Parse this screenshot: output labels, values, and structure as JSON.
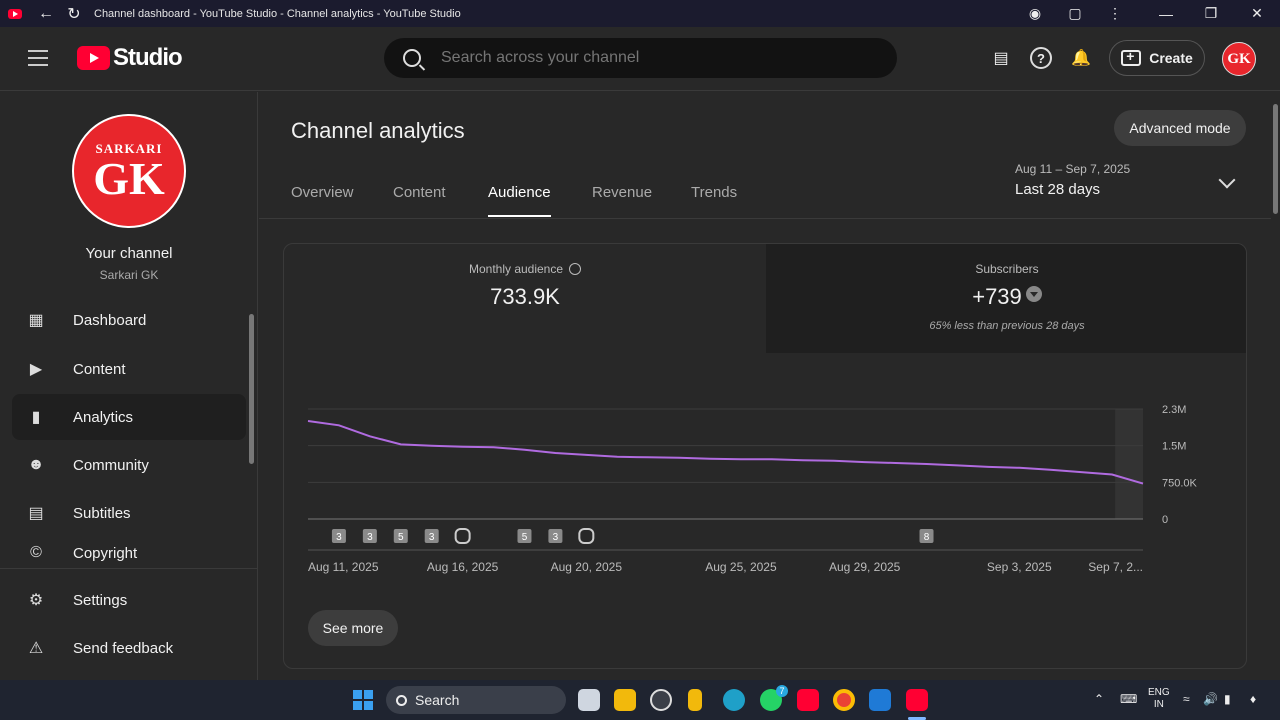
{
  "browser": {
    "title": "Channel dashboard - YouTube Studio - Channel analytics - YouTube Studio"
  },
  "header": {
    "logo_text": "Studio",
    "search_placeholder": "Search across your channel",
    "create_label": "Create",
    "avatar_text": "GK"
  },
  "sidebar": {
    "avatar_top": "SARKARI",
    "avatar_main": "GK",
    "channel_title": "Your channel",
    "channel_name": "Sarkari GK",
    "items": [
      {
        "label": "Dashboard",
        "icon": "dashboard-icon"
      },
      {
        "label": "Content",
        "icon": "content-icon"
      },
      {
        "label": "Analytics",
        "icon": "analytics-icon"
      },
      {
        "label": "Community",
        "icon": "community-icon"
      },
      {
        "label": "Subtitles",
        "icon": "subtitles-icon"
      },
      {
        "label": "Copyright",
        "icon": "copyright-icon"
      },
      {
        "label": "Settings",
        "icon": "settings-icon"
      },
      {
        "label": "Send feedback",
        "icon": "feedback-icon"
      }
    ]
  },
  "main": {
    "title": "Channel analytics",
    "advanced_mode": "Advanced mode",
    "tabs": [
      "Overview",
      "Content",
      "Audience",
      "Revenue",
      "Trends"
    ],
    "active_tab": "Audience",
    "date_range": "Aug 11 – Sep 7, 2025",
    "date_label": "Last 28 days",
    "metrics": {
      "monthly_audience_label": "Monthly audience",
      "monthly_audience_value": "733.9K",
      "subscribers_label": "Subscribers",
      "subscribers_value": "+739",
      "subscribers_note": "65% less than previous 28 days"
    },
    "see_more": "See more"
  },
  "chart_data": {
    "type": "line",
    "y_tick_labels": [
      "2.3M",
      "1.5M",
      "750.0K",
      "0"
    ],
    "x_tick_labels": [
      "Aug 11, 2025",
      "Aug 16, 2025",
      "Aug 20, 2025",
      "Aug 25, 2025",
      "Aug 29, 2025",
      "Sep 3, 2025",
      "Sep 7, 2..."
    ],
    "ylim": [
      0,
      2300000
    ],
    "series": [
      {
        "color": "#b06be0",
        "values": [
          2050000,
          1960000,
          1730000,
          1560000,
          1530000,
          1510000,
          1500000,
          1450000,
          1380000,
          1340000,
          1300000,
          1290000,
          1280000,
          1260000,
          1250000,
          1250000,
          1230000,
          1220000,
          1190000,
          1170000,
          1150000,
          1120000,
          1090000,
          1070000,
          1030000,
          980000,
          930000,
          740000
        ]
      }
    ],
    "markers": [
      {
        "day": 1,
        "label": "3"
      },
      {
        "day": 2,
        "label": "3"
      },
      {
        "day": 3,
        "label": "5"
      },
      {
        "day": 4,
        "label": "3"
      },
      {
        "day": 5,
        "label": "shorts"
      },
      {
        "day": 7,
        "label": "5"
      },
      {
        "day": 8,
        "label": "3"
      },
      {
        "day": 9,
        "label": "shorts"
      },
      {
        "day": 20,
        "label": "8"
      }
    ]
  },
  "taskbar": {
    "search_label": "Search",
    "lang_top": "ENG",
    "lang_bottom": "IN",
    "whatsapp_badge": "7"
  }
}
